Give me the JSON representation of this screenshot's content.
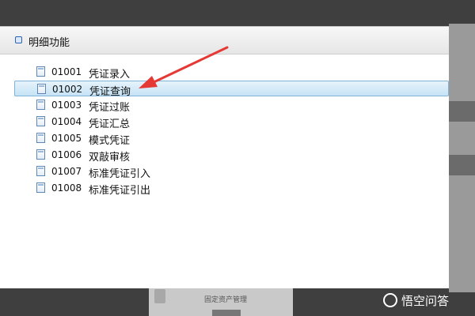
{
  "dialog": {
    "title": "明细功能",
    "items": [
      {
        "code": "01001",
        "name": "凭证录入",
        "selected": false
      },
      {
        "code": "01002",
        "name": "凭证查询",
        "selected": true
      },
      {
        "code": "01003",
        "name": "凭证过账",
        "selected": false
      },
      {
        "code": "01004",
        "name": "凭证汇总",
        "selected": false
      },
      {
        "code": "01005",
        "name": "模式凭证",
        "selected": false
      },
      {
        "code": "01006",
        "name": "双敲审核",
        "selected": false
      },
      {
        "code": "01007",
        "name": "标准凭证引入",
        "selected": false
      },
      {
        "code": "01008",
        "name": "标准凭证引出",
        "selected": false
      }
    ]
  },
  "background": {
    "bottom_label": "固定资产管理"
  },
  "annotation": {
    "arrow_color": "#e53935"
  },
  "watermark": {
    "text": "悟空问答"
  },
  "colors": {
    "selected_bg": "#c6e3f5",
    "selected_border": "#7fb4d8",
    "header_icon": "#2a63b7"
  }
}
